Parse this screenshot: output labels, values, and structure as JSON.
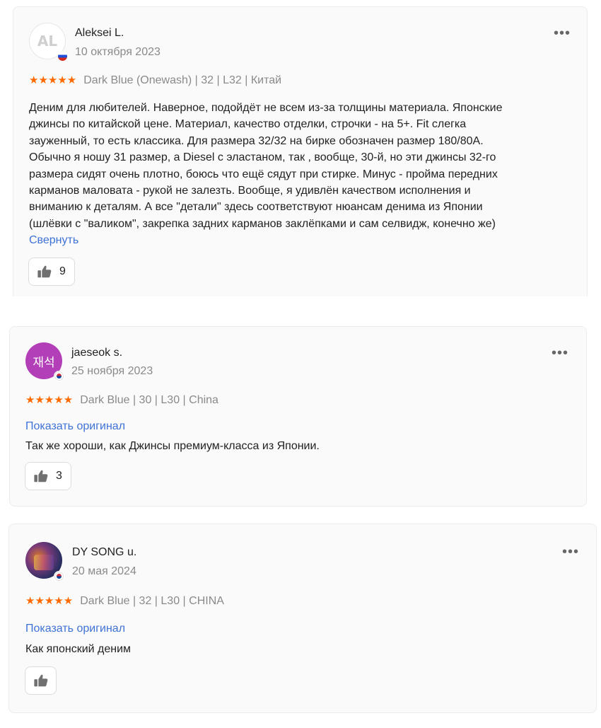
{
  "reviews": [
    {
      "avatar_initials": "AL",
      "avatar_icon": "initials-avatar",
      "flag_icon": "russia-flag-icon",
      "author": "Aleksei L.",
      "date": "10 октября 2023",
      "rating": 5,
      "stars": "★★★★★",
      "meta": "Dark Blue (Onewash) | 32 | L32 | Китай",
      "text": "Деним для любителей. Наверное, подойдёт не всем из-за толщины материала. Японские\nджинсы по китайской цене. Материал, качество отделки, строчки - на 5+. Fit слегка\nзауженный, то есть классика. Для размера 32/32 на бирке обозначен размер 180/80A.\nОбычно я ношу 31 размер, а Diesel с эластаном, так , вообще, 30-й, но эти джинсы 32-го\nразмера сидят очень плотно, боюсь что ещё сядут при стирке. Минус - пройма передних\nкарманов маловата - рукой не залезть. Вообще, я удивлён качеством исполнения и\nвниманию к деталям. А все \"детали\" здесь соответствуют нюансам денима из Японии\n(шлёвки с \"валиком\", закрепка задних карманов заклёпками и сам селвидж, конечно же)",
      "toggle_link": "Свернуть",
      "likes": "9"
    },
    {
      "avatar_text": "재석",
      "avatar_icon": "korean-text-avatar",
      "flag_icon": "south-korea-flag-icon",
      "author": "jaeseok s.",
      "date": "25 ноября 2023",
      "rating": 5,
      "stars": "★★★★★",
      "meta": "Dark Blue | 30 | L30 | China",
      "show_original": "Показать оригинал",
      "text": "Так же хороши, как Джинсы премиум-класса из Японии.",
      "likes": "3"
    },
    {
      "avatar_icon": "photo-avatar",
      "flag_icon": "south-korea-flag-icon",
      "author": "DY SONG u.",
      "date": "20 мая 2024",
      "rating": 5,
      "stars": "★★★★★",
      "meta": "Dark Blue | 32 | L30 | CHINA",
      "show_original": "Показать оригинал",
      "text": "Как японский деним",
      "likes": ""
    }
  ],
  "more_label": "•••",
  "colors": {
    "stars": "#ff6a00",
    "link": "#3f72d6",
    "muted": "#8a8a8a"
  }
}
